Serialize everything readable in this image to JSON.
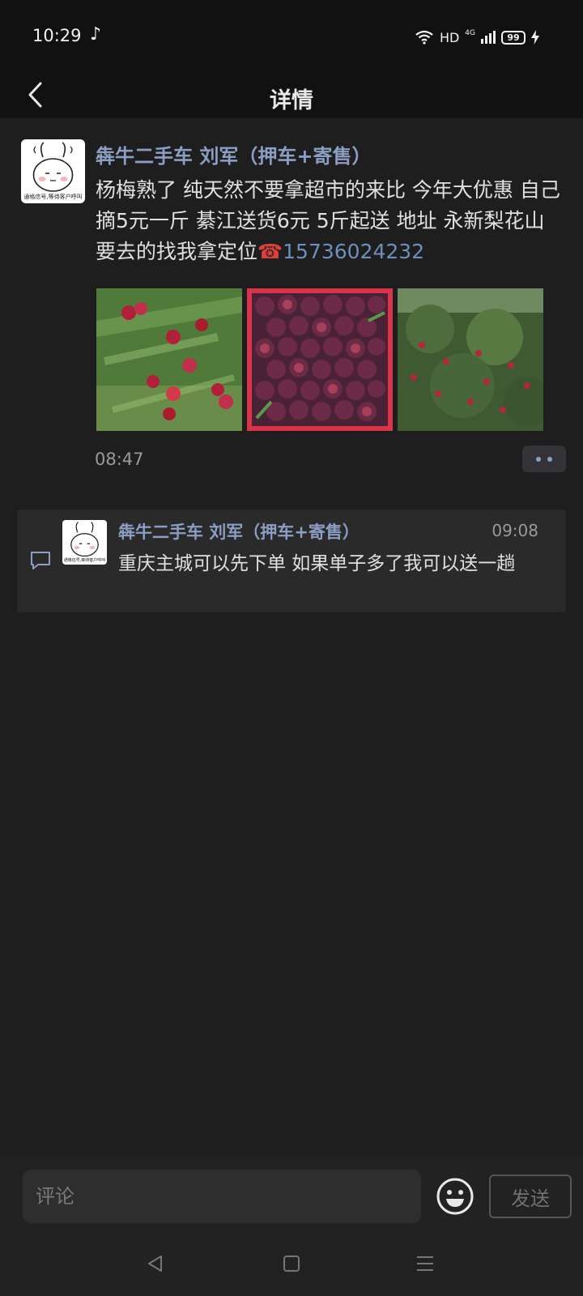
{
  "status_bar": {
    "time": "10:29",
    "network_type": "HD",
    "network_gen": "4G",
    "battery_level": "99"
  },
  "header": {
    "title": "详情"
  },
  "post": {
    "author": "犇牛二手车 刘军（押车+寄售）",
    "avatar_caption": "通格信号,等待客户呼叫",
    "text": "杨梅熟了 纯天然不要拿超市的来比 今年大优惠 自己摘5元一斤 綦江送货6元 5斤起送  地址 永新梨花山 要去的找我拿定位",
    "phone_icon": "☎",
    "phone": "15736024232",
    "time": "08:47",
    "images": [
      "bayberry-tree-photo",
      "bayberry-basket-photo",
      "bayberry-orchard-photo"
    ]
  },
  "comment": {
    "author": "犇牛二手车 刘军（押车+寄售）",
    "avatar_caption": "通格信号,等待客户呼叫",
    "time": "09:08",
    "text": "重庆主城可以先下单  如果单子多了我可以送一趟"
  },
  "input_bar": {
    "placeholder": "评论",
    "send_label": "发送"
  },
  "colors": {
    "accent": "#8b9ec4",
    "link": "#6e8ebd",
    "background": "#1e1e1e"
  }
}
